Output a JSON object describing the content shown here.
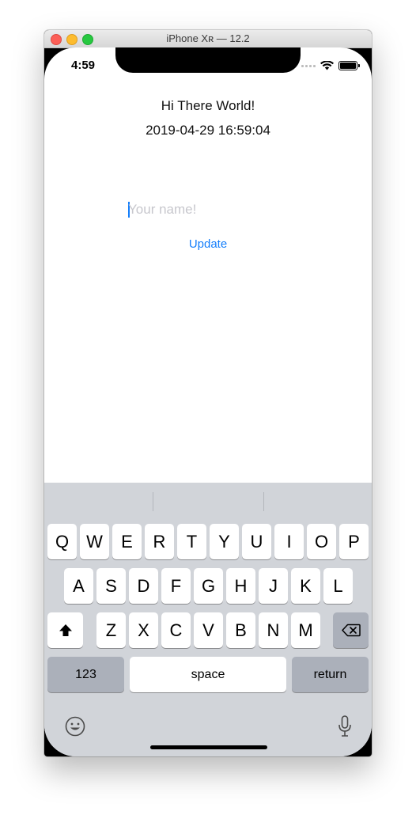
{
  "window": {
    "title": "iPhone Xʀ — 12.2"
  },
  "status_bar": {
    "time": "4:59",
    "icons": [
      "signal-icon",
      "wifi-icon",
      "battery-icon"
    ]
  },
  "app": {
    "greeting": "Hi There World!",
    "datetime": "2019-04-29 16:59:04",
    "name_input": {
      "value": "",
      "placeholder": "Your name!"
    },
    "update_label": "Update"
  },
  "keyboard": {
    "row1": [
      "Q",
      "W",
      "E",
      "R",
      "T",
      "Y",
      "U",
      "I",
      "O",
      "P"
    ],
    "row2": [
      "A",
      "S",
      "D",
      "F",
      "G",
      "H",
      "J",
      "K",
      "L"
    ],
    "row3": [
      "Z",
      "X",
      "C",
      "V",
      "B",
      "N",
      "M"
    ],
    "numbers_label": "123",
    "space_label": "space",
    "return_label": "return",
    "icons": [
      "shift-icon",
      "backspace-icon",
      "emoji-icon",
      "microphone-icon"
    ]
  },
  "colors": {
    "accent": "#147efb",
    "keyboard_bg": "#d1d4d9",
    "function_key": "#abb0ba"
  }
}
